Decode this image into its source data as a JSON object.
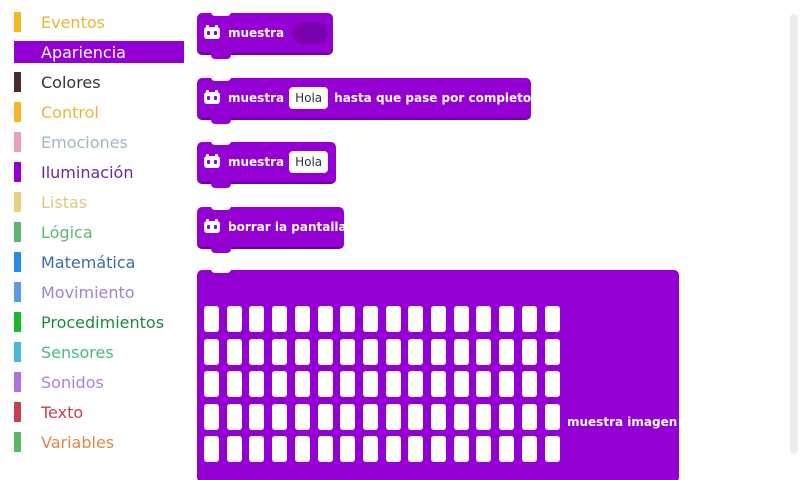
{
  "sidebar": {
    "categories": [
      {
        "label": "Eventos",
        "color": "#f5b820",
        "text_color": "#e8b73a"
      },
      {
        "label": "Apariencia",
        "color": "#9400d3",
        "text_color": "#ffffff",
        "selected": true
      },
      {
        "label": "Colores",
        "color": "#4a2a2a",
        "text_color": "#333333"
      },
      {
        "label": "Control",
        "color": "#f5b820",
        "text_color": "#e8b73a"
      },
      {
        "label": "Emociones",
        "color": "#e8a0c0",
        "text_color": "#a0b8c0"
      },
      {
        "label": "Iluminación",
        "color": "#9400d3",
        "text_color": "#6a2a9a"
      },
      {
        "label": "Listas",
        "color": "#e8d080",
        "text_color": "#e0c880"
      },
      {
        "label": "Lógica",
        "color": "#5cb870",
        "text_color": "#5cb870"
      },
      {
        "label": "Matemática",
        "color": "#2a8ae8",
        "text_color": "#3a6ab0"
      },
      {
        "label": "Movimiento",
        "color": "#5a9ae8",
        "text_color": "#a080d0"
      },
      {
        "label": "Procedimientos",
        "color": "#1ab830",
        "text_color": "#1a8a3a"
      },
      {
        "label": "Sensores",
        "color": "#4ab8d8",
        "text_color": "#4ab880"
      },
      {
        "label": "Sonidos",
        "color": "#b070e0",
        "text_color": "#b080d8"
      },
      {
        "label": "Texto",
        "color": "#c84050",
        "text_color": "#c84050"
      },
      {
        "label": "Variables",
        "color": "#5cb860",
        "text_color": "#e0884a"
      }
    ]
  },
  "blocks": {
    "show_color": {
      "label": "muestra"
    },
    "show_until_done": {
      "label": "muestra",
      "field": "Hola",
      "suffix": "hasta que pase por completo"
    },
    "show_text": {
      "label": "muestra",
      "field": "Hola"
    },
    "clear_screen": {
      "label": "borrar la pantalla"
    },
    "show_image": {
      "label": "muestra imagen"
    }
  },
  "colors": {
    "accent": "#9400d3"
  }
}
